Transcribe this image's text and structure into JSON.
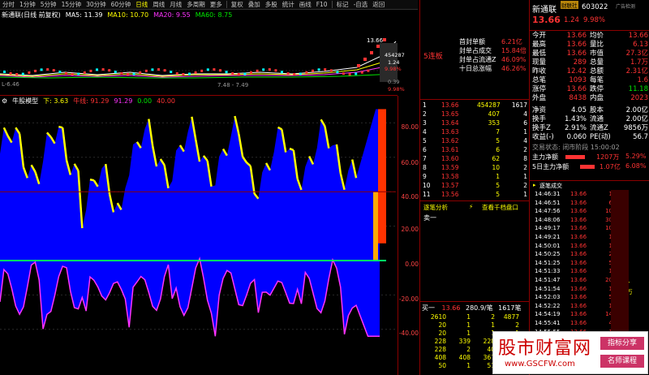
{
  "toolbar": {
    "items": [
      "分时",
      "1分钟",
      "5分钟",
      "15分钟",
      "30分钟",
      "60分钟",
      "日线",
      "周线",
      "月线",
      "多周期",
      "更多",
      "复权",
      "叠加",
      "多股",
      "统计",
      "画线",
      "F10",
      "标记",
      "-自选",
      "返回"
    ]
  },
  "chart_header": {
    "title": "新通联(日线 前复权)",
    "ma5": "MA5: 11.39",
    "ma10": "MA10: 10.70",
    "ma20": "MA20: 9.55",
    "ma60": "MA60: 8.75"
  },
  "price_panel": {
    "high_label": "13.66",
    "low_label": "L-6.46",
    "range_label": "7.48 - 7.49",
    "vol_labels": [
      "454287",
      "1.24",
      "9.98%"
    ],
    "side_labels": [
      "0.39",
      "9.98%"
    ]
  },
  "indicator_bar": {
    "name": "牛股模型",
    "down_label": "下: 3.63",
    "up_label": "牛线: 91.29",
    "v2": "91.29",
    "v3": "0.00",
    "v4": "40.00"
  },
  "indicator_axis": [
    "80.00",
    "60.00",
    "40.00",
    "20.00",
    "0.00",
    "-20.00",
    "-40.00"
  ],
  "order_book": {
    "lu_title": "5连板",
    "lu_lines": [
      {
        "label": "首封单额",
        "value": "6.21亿"
      },
      {
        "label": "封单占成交",
        "value": "15.84倍"
      },
      {
        "label": "封单占流通Z",
        "value": "46.09%"
      },
      {
        "label": "十日总涨幅",
        "value": "46.26%"
      }
    ],
    "bids": [
      {
        "n": "1",
        "p": "13.66",
        "v": "454287",
        "c": "1617"
      },
      {
        "n": "2",
        "p": "13.65",
        "v": "407",
        "c": "4"
      },
      {
        "n": "3",
        "p": "13.64",
        "v": "353",
        "c": "6"
      },
      {
        "n": "4",
        "p": "13.63",
        "v": "7",
        "c": "1"
      },
      {
        "n": "5",
        "p": "13.62",
        "v": "5",
        "c": "4"
      },
      {
        "n": "6",
        "p": "13.61",
        "v": "6",
        "c": "2"
      },
      {
        "n": "7",
        "p": "13.60",
        "v": "62",
        "c": "8"
      },
      {
        "n": "8",
        "p": "13.59",
        "v": "10",
        "c": "2"
      },
      {
        "n": "9",
        "p": "13.58",
        "v": "1",
        "c": "1"
      },
      {
        "n": "10",
        "p": "13.57",
        "v": "5",
        "c": "2"
      },
      {
        "n": "11",
        "p": "13.56",
        "v": "5",
        "c": "1"
      }
    ],
    "links": [
      "逐笔分析",
      "查看千档盘口"
    ],
    "sell_label": "卖一",
    "buy1": {
      "label": "买一",
      "price": "13.66",
      "per": "280.9/笔",
      "count": "1617笔"
    },
    "queue": [
      [
        "2610",
        "1",
        "2",
        "4877"
      ],
      [
        "20",
        "1",
        "1",
        "2"
      ],
      [
        "20",
        "1",
        "1",
        "1"
      ],
      [
        "228",
        "339",
        "228",
        "1"
      ],
      [
        "228",
        "2",
        "40",
        "1"
      ],
      [
        "408",
        "408",
        "367",
        "1"
      ],
      [
        "50",
        "1",
        "51",
        "1"
      ]
    ]
  },
  "right_panel": {
    "name": "新通联",
    "code": "603022",
    "price": "13.66",
    "change": "1.24",
    "pct": "9.98%",
    "tag": "财联社",
    "ad": "广告检测",
    "quotes": [
      {
        "l": "今开",
        "v": "13.66",
        "l2": "均价",
        "v2": "13.66"
      },
      {
        "l": "最高",
        "v": "13.66",
        "l2": "量比",
        "v2": "6.13"
      },
      {
        "l": "最低",
        "v": "13.66",
        "l2": "市值",
        "v2": "27.3亿"
      },
      {
        "l": "现量",
        "v": "289",
        "l2": "总量",
        "v2": "1.7万"
      },
      {
        "l": "昨收",
        "v": "12.42",
        "l2": "总额",
        "v2": "2.31亿"
      },
      {
        "l": "总笔",
        "v": "1093",
        "l2": "每笔",
        "v2": "1.6"
      },
      {
        "l": "涨停",
        "v": "13.66",
        "l2": "跌停",
        "v2": "11.18"
      },
      {
        "l": "外盘",
        "v": "8438",
        "l2": "内盘",
        "v2": "2023"
      },
      {
        "l": "净资",
        "v": "4.05",
        "l2": "股本",
        "v2": "2.00亿"
      },
      {
        "l": "换手",
        "v": "1.43%",
        "l2": "流通",
        "v2": "2.00亿"
      },
      {
        "l": "换手Z",
        "v": "2.91%",
        "l2": "流通Z",
        "v2": "9856万"
      },
      {
        "l": "收益(-)",
        "v": "0.060",
        "l2": "PE(动)",
        "v2": "56.7"
      }
    ],
    "trade_state": "交易状态: 闭市阶段 15:00:02",
    "main_net_label": "主力净额",
    "main_net": "1207万",
    "main_net_pct": "5.29%",
    "main_5d_label": "5日主力净额",
    "main_5d": "1.07亿",
    "main_5d_pct": "6.08%",
    "tick_title": "逐笔成交",
    "ticks": [
      {
        "t": "14:46:31",
        "p": "13.66",
        "v": "1"
      },
      {
        "t": "14:46:51",
        "p": "13.66",
        "v": "6"
      },
      {
        "t": "14:47:56",
        "p": "13.66",
        "v": "10"
      },
      {
        "t": "14:48:06",
        "p": "13.66",
        "v": "30"
      },
      {
        "t": "14:49:17",
        "p": "13.66",
        "v": "10"
      },
      {
        "t": "14:49:21",
        "p": "13.66",
        "v": "1"
      },
      {
        "t": "14:50:01",
        "p": "13.66",
        "v": "1"
      },
      {
        "t": "14:50:25",
        "p": "13.66",
        "v": "2"
      },
      {
        "t": "14:51:25",
        "p": "13.66",
        "v": "5"
      },
      {
        "t": "14:51:33",
        "p": "13.66",
        "v": "1"
      },
      {
        "t": "14:51:47",
        "p": "13.66",
        "v": "20"
      },
      {
        "t": "14:51:54",
        "p": "13.66",
        "v": "1"
      },
      {
        "t": "14:52:03",
        "p": "13.66",
        "v": "5"
      },
      {
        "t": "14:52:22",
        "p": "13.66",
        "v": "1"
      },
      {
        "t": "14:54:19",
        "p": "13.66",
        "v": "14"
      },
      {
        "t": "14:55:41",
        "p": "13.66",
        "v": "4"
      },
      {
        "t": "14:55:55",
        "p": "13.66",
        "v": "1"
      },
      {
        "t": "14:56:30",
        "p": "13.66",
        "v": "1"
      },
      {
        "t": "14:56:50",
        "p": "13.66",
        "v": "4"
      },
      {
        "t": "14:56:56",
        "p": "13.66",
        "v": "1"
      },
      {
        "t": "15:00:02",
        "p": "13.66",
        "v": "289"
      }
    ],
    "side_vals": [
      "647",
      "88.4万"
    ]
  },
  "watermark": {
    "main": "股市财富网",
    "url": "www.GSCFW.com",
    "tag1": "指标分享",
    "tag2": "名师课程"
  },
  "colors": {
    "up": "#ff3333",
    "down": "#00e600",
    "accent": "#ffff00",
    "fill_blue": "#0000ff",
    "magenta": "#ff33ff",
    "zero_line": "#00ff66"
  }
}
